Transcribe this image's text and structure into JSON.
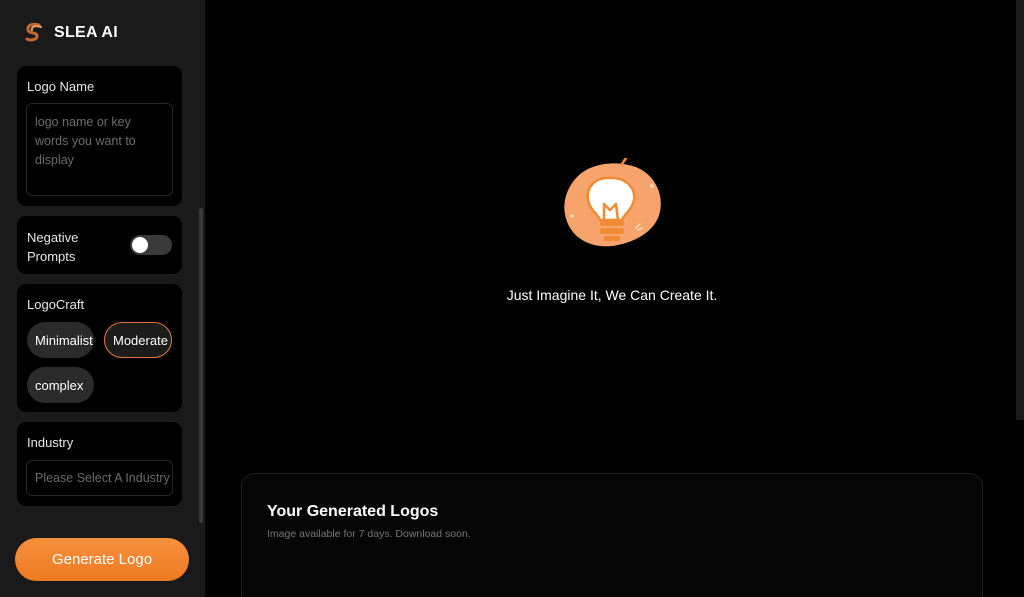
{
  "brand": {
    "name": "SLEA AI",
    "icon": "slea-logo-icon"
  },
  "sidebar": {
    "logo_name": {
      "label": "Logo Name",
      "placeholder": "logo name or key words you want to display"
    },
    "negative_prompts": {
      "label": "Negative Prompts",
      "enabled": false
    },
    "logocraft": {
      "label": "LogoCraft",
      "options": [
        "Minimalist",
        "Moderate",
        "complex"
      ],
      "selected": "Moderate"
    },
    "industry": {
      "label": "Industry",
      "placeholder": "Please Select A Industry"
    },
    "generate_label": "Generate Logo"
  },
  "main": {
    "illustration_icon": "lightbulb-icon",
    "tagline": "Just Imagine It, We Can Create It.",
    "generated": {
      "title": "Your Generated Logos",
      "subtitle": "Image available for 7 days. Download soon."
    }
  },
  "colors": {
    "accent": "#f08a33",
    "sidebar_bg": "#1a1a1a",
    "card_bg": "#000000"
  }
}
